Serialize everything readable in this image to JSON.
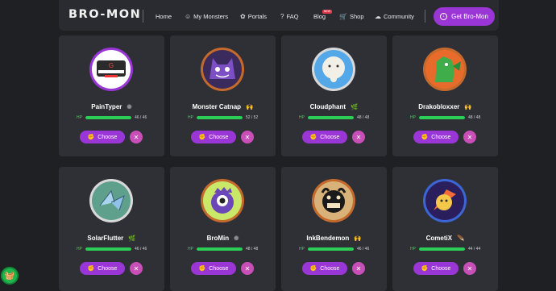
{
  "header": {
    "logo": "BRO-MON",
    "nav": [
      {
        "label": "Home",
        "icon": ""
      },
      {
        "label": "My Monsters",
        "icon": "☺"
      },
      {
        "label": "Portals",
        "icon": "✿"
      },
      {
        "label": "FAQ",
        "icon": "?"
      },
      {
        "label": "Blog",
        "icon": ""
      },
      {
        "label": "Shop",
        "icon": "🛒"
      },
      {
        "label": "Community",
        "icon": "☁"
      }
    ],
    "new_badge": "NEW",
    "cta_label": "Get Bro-Mon",
    "cta_icon": "↓"
  },
  "monsters": [
    {
      "name": "PainTyper",
      "badge": "✺",
      "badge_color": "#8a8b90",
      "hp_label": "HP",
      "hp_text": "46 / 46",
      "hp_pct": 100,
      "choose": "Choose",
      "avatar": "paintyper",
      "ring": "#9b36d6"
    },
    {
      "name": "Monster Catnap",
      "badge": "🙌",
      "badge_color": "#f5c13a",
      "hp_label": "HP",
      "hp_text": "52 / 52",
      "hp_pct": 100,
      "choose": "Choose",
      "avatar": "catnap",
      "ring": "#c46a2c"
    },
    {
      "name": "Cloudphant",
      "badge": "🌿",
      "badge_color": "#7ac36a",
      "hp_label": "HP",
      "hp_text": "48 / 48",
      "hp_pct": 100,
      "choose": "Choose",
      "avatar": "cloudphant",
      "ring": "#d9d9d9"
    },
    {
      "name": "Drakobloxxer",
      "badge": "🙌",
      "badge_color": "#f5c13a",
      "hp_label": "HP",
      "hp_text": "48 / 48",
      "hp_pct": 100,
      "choose": "Choose",
      "avatar": "drako",
      "ring": "#c46a2c"
    },
    {
      "name": "SolarFlutter",
      "badge": "🌿",
      "badge_color": "#7ac36a",
      "hp_label": "HP",
      "hp_text": "46 / 46",
      "hp_pct": 100,
      "choose": "Choose",
      "avatar": "solar",
      "ring": "#d9d9d9"
    },
    {
      "name": "BroMin",
      "badge": "✺",
      "badge_color": "#8a8b90",
      "hp_label": "HP",
      "hp_text": "48 / 48",
      "hp_pct": 100,
      "choose": "Choose",
      "avatar": "bromin",
      "ring": "#c46a2c"
    },
    {
      "name": "InkBendemon",
      "badge": "🙌",
      "badge_color": "#f5c13a",
      "hp_label": "HP",
      "hp_text": "46 / 46",
      "hp_pct": 100,
      "choose": "Choose",
      "avatar": "ink",
      "ring": "#c46a2c"
    },
    {
      "name": "CometiX",
      "badge": "🪶",
      "badge_color": "#8b5cf6",
      "hp_label": "HP",
      "hp_text": "44 / 44",
      "hp_pct": 100,
      "choose": "Choose",
      "avatar": "cometix",
      "ring": "#3b66d4"
    }
  ],
  "float_button_icon": "🧺"
}
